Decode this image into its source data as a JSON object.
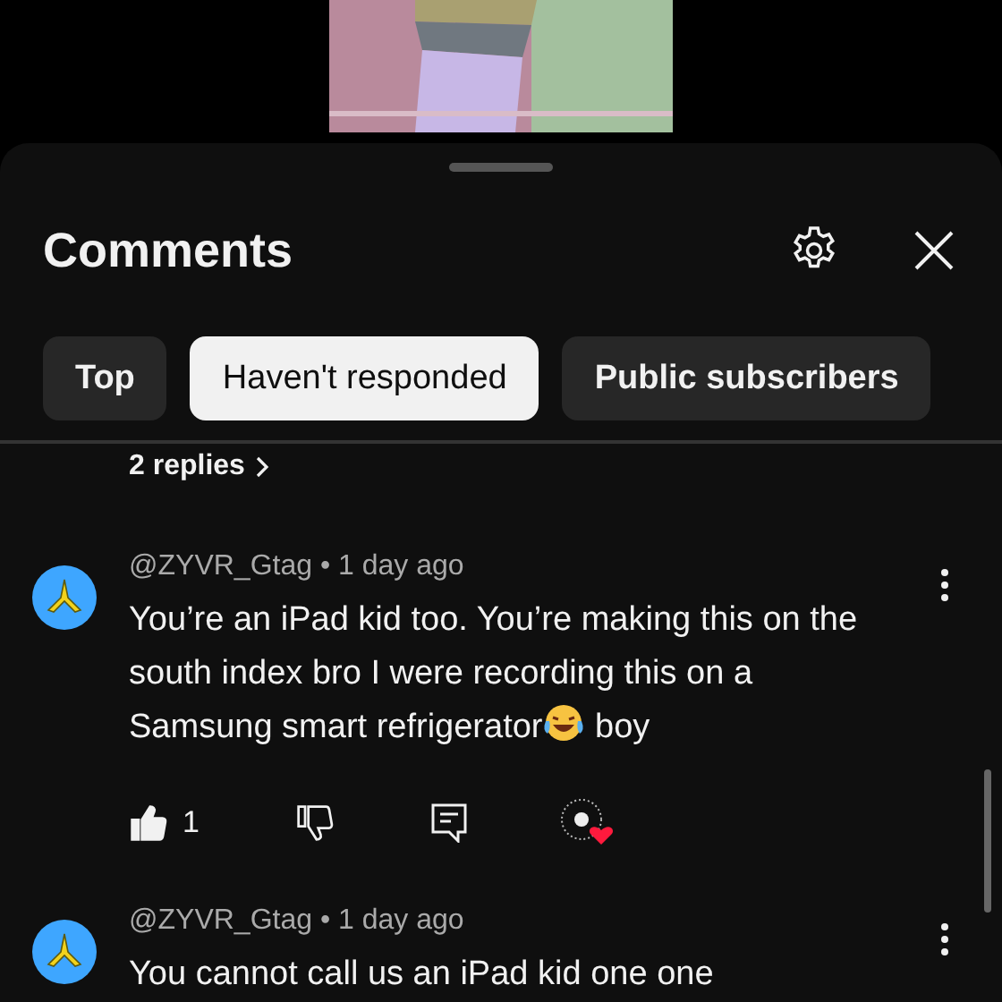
{
  "panel": {
    "title": "Comments"
  },
  "chips": [
    {
      "label": "Top",
      "selected": false
    },
    {
      "label": "Haven't responded",
      "selected": true
    },
    {
      "label": "Public subscribers",
      "selected": false
    }
  ],
  "replies_link": "2 replies",
  "meta_separator": "•",
  "comments": [
    {
      "author": "@ZYVR_Gtag",
      "time": "1 day ago",
      "body": [
        {
          "kind": "text",
          "text": "You’re an iPad kid too. You’re making this on the south index bro I were recording this on a Samsung smart refrigerator"
        },
        {
          "kind": "emoji"
        },
        {
          "kind": "text",
          "text": " boy"
        }
      ],
      "likes": "1",
      "liked": true,
      "hearted": true
    },
    {
      "author": "@ZYVR_Gtag",
      "time": "1 day ago",
      "body": [
        {
          "kind": "text",
          "text": "You cannot call us an iPad kid one one"
        }
      ]
    }
  ]
}
